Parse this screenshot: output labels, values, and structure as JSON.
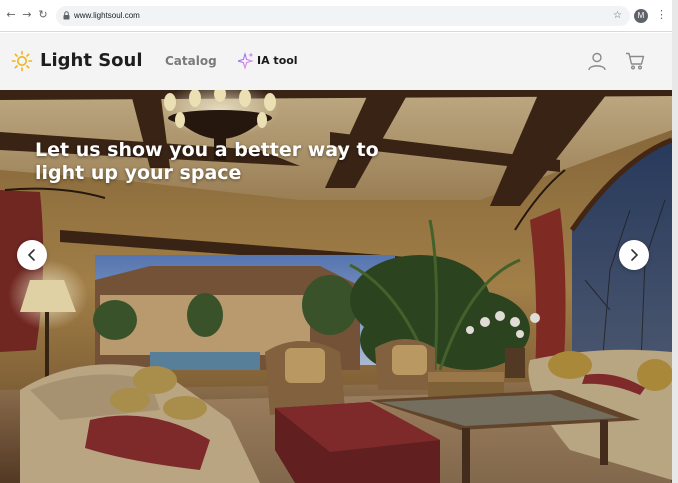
{
  "browser": {
    "url": "www.lightsoul.com",
    "profile_initial": "M",
    "icons": [
      "back-arrow-icon",
      "forward-arrow-icon",
      "reload-icon",
      "lock-icon",
      "star-icon",
      "kebab-menu-icon"
    ]
  },
  "header": {
    "brand": "Light Soul",
    "nav": {
      "catalog": "Catalog",
      "ia_tool": "IA tool"
    },
    "icons": [
      "sun-logo-icon",
      "sparkle-icon",
      "user-icon",
      "cart-icon"
    ]
  },
  "hero": {
    "headline_line1": "Let us show you a better way to",
    "headline_line2": "light up your space",
    "icons": [
      "chevron-left-icon",
      "chevron-right-icon"
    ]
  },
  "colors": {
    "header_bg": "#f4f4f4",
    "brand_text": "#1e1e1e",
    "nav_muted": "#7a7a7a",
    "ia_gradient_start": "#7b61ff",
    "ia_gradient_end": "#ff9ad5",
    "logo_sun": "#f2b31c"
  }
}
